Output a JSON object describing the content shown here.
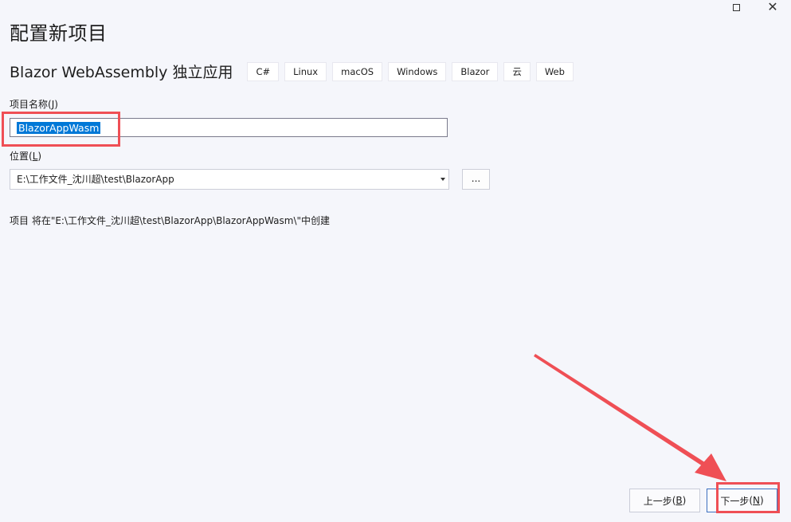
{
  "window": {
    "controls": [
      {
        "name": "maximize-button",
        "glyph": ""
      },
      {
        "name": "close-button",
        "glyph": "✕"
      }
    ]
  },
  "page": {
    "title": "配置新项目",
    "template_name": "Blazor WebAssembly 独立应用",
    "tags": [
      "C#",
      "Linux",
      "macOS",
      "Windows",
      "Blazor",
      "云",
      "Web"
    ]
  },
  "form": {
    "project_name_label": "项目名称",
    "project_name_accel": "J",
    "project_name_value": "BlazorAppWasm",
    "location_label": "位置",
    "location_accel": "L",
    "location_value": "E:\\工作文件_沈川超\\test\\BlazorApp",
    "browse_label": "...",
    "info_text": "项目 将在\"E:\\工作文件_沈川超\\test\\BlazorApp\\BlazorAppWasm\\\"中创建"
  },
  "footer": {
    "back_label": "上一步",
    "back_accel": "B",
    "next_label": "下一步",
    "next_accel": "N"
  },
  "colors": {
    "background": "#f5f6fb",
    "selection": "#0078d7",
    "annotation_red": "#ef4f55",
    "primary_border": "#3c6fbf"
  }
}
